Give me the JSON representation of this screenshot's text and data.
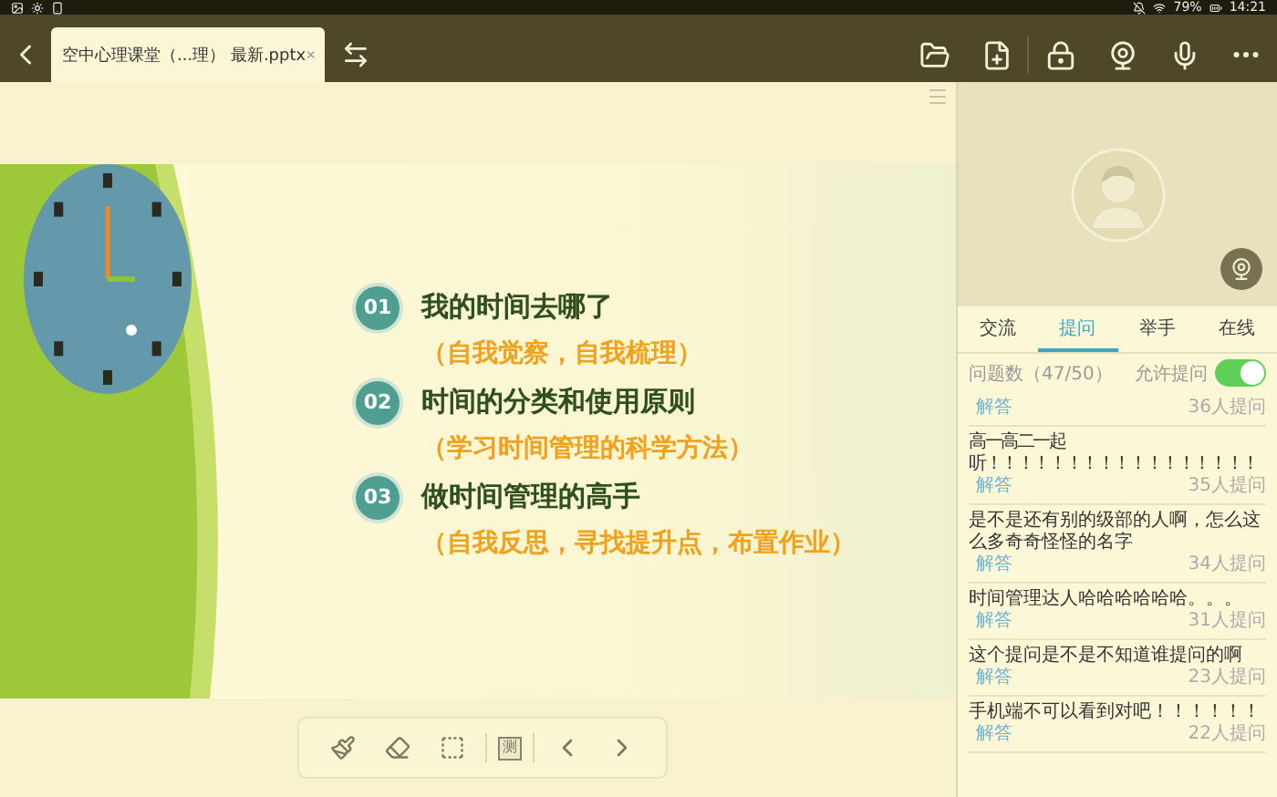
{
  "status_bar": {
    "battery": "79%",
    "time": "14:21"
  },
  "file_tab": {
    "title": "空中心理课堂（...理） 最新.pptx",
    "close": "×"
  },
  "slide": {
    "items": [
      {
        "number": "01",
        "title": "我的时间去哪了",
        "subtitle": "（自我觉察，自我梳理）"
      },
      {
        "number": "02",
        "title": "时间的分类和使用原则",
        "subtitle": "（学习时间管理的科学方法）"
      },
      {
        "number": "03",
        "title": "做时间管理的高手",
        "subtitle": "（自我反思，寻找提升点，布置作业）"
      }
    ]
  },
  "slide_toolbar": {
    "test_label": "测"
  },
  "panel": {
    "tabs": [
      {
        "label": "交流",
        "selected": false
      },
      {
        "label": "提问",
        "selected": true
      },
      {
        "label": "举手",
        "selected": false
      },
      {
        "label": "在线",
        "selected": false
      }
    ],
    "question_count": "问题数（47/50）",
    "allow_label": "允许提问",
    "allow_on": true,
    "questions": [
      {
        "answer": "解答",
        "count": "36人提问"
      },
      {
        "lines": [
          "高一高二一起",
          "听！！！！！！！！！！！！！！！！！"
        ],
        "answer": "解答",
        "count": "35人提问"
      },
      {
        "text": "是不是还有别的级部的人啊，怎么这么多奇奇怪怪的名字",
        "answer": "解答",
        "count": "34人提问"
      },
      {
        "text": "时间管理达人哈哈哈哈哈哈。。。",
        "answer": "解答",
        "count": "31人提问"
      },
      {
        "text": "这个提问是不是不知道谁提问的啊",
        "answer": "解答",
        "count": "23人提问"
      },
      {
        "text": "手机端不可以看到对吧！！！！！！",
        "answer": "解答",
        "count": "22人提问"
      }
    ]
  }
}
